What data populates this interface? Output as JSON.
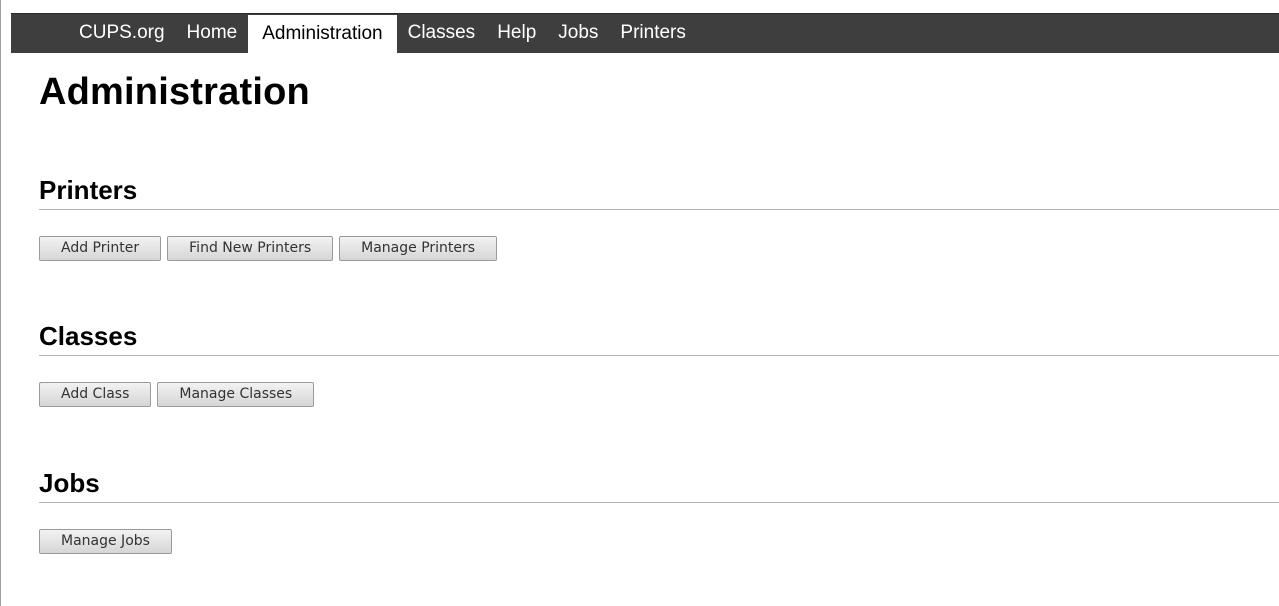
{
  "nav": {
    "items": [
      {
        "label": "CUPS.org",
        "active": false
      },
      {
        "label": "Home",
        "active": false
      },
      {
        "label": "Administration",
        "active": true
      },
      {
        "label": "Classes",
        "active": false
      },
      {
        "label": "Help",
        "active": false
      },
      {
        "label": "Jobs",
        "active": false
      },
      {
        "label": "Printers",
        "active": false
      }
    ]
  },
  "page": {
    "title": "Administration"
  },
  "sections": {
    "printers": {
      "heading": "Printers",
      "buttons": [
        "Add Printer",
        "Find New Printers",
        "Manage Printers"
      ]
    },
    "classes": {
      "heading": "Classes",
      "buttons": [
        "Add Class",
        "Manage Classes"
      ]
    },
    "jobs": {
      "heading": "Jobs",
      "buttons": [
        "Manage Jobs"
      ]
    }
  },
  "colors": {
    "navbar_bg": "#3e3e3e",
    "nav_active_bg": "#ffffff",
    "rule": "#b5b5b5"
  }
}
